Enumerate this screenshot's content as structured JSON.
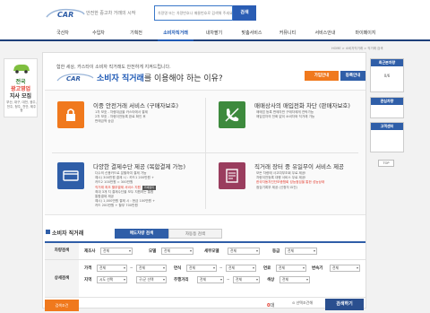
{
  "header": {
    "tagline": "안전한 중고차 거래의 시작",
    "search_placeholder": "차량명 또는 차량번호나 매물번호로 검색해 주세요",
    "search_button": "검색"
  },
  "nav": {
    "items": [
      "국산차",
      "수입차",
      "기획전",
      "소비자직거래",
      "내차팔기",
      "맞춤서비스",
      "커뮤니티",
      "서비스안내",
      "마이페이지"
    ],
    "active_index": 3
  },
  "left_banner": {
    "line1": "전국",
    "line2": "광고영업",
    "line3": "지사 모집",
    "sub": "부산, 대구, 대전, 광주, 전주, 청주, 천안, 제주 등"
  },
  "breadcrumb": "HOME > 소비자직거래 > 직거래 검색",
  "intro": {
    "text": "험한 세상, 카스타이 소비자 직거래도 안전하게 지켜드립니다.",
    "headline_pre": "",
    "headline_highlight": "소비자 직거래",
    "headline_post": "를 이용해야 하는 이유?",
    "btn_howto": "가입안내",
    "btn_register": "등록안내"
  },
  "features": [
    {
      "title": "이중 안전거래 서비스 (구매자보호)",
      "items": [
        "1차 보호 - 차량대금을 카스타에서 결제",
        "2차 보호 - 차량이전등록 완료 확인 후",
        "판매금액 송금"
      ],
      "color": "#f0791d",
      "icon": "lock-icon"
    },
    {
      "title": "매매상사의 매입전화 차단 (판매자보호)",
      "items": [
        "매매업 등록 판매자만 구매자에게 연락가능",
        "매입업자의 전화 없이 소비자와 직거래 가능"
      ],
      "color": "#3d8a3d",
      "icon": "phone-block-icon"
    },
    {
      "title": "다양한 결제수단 제공 (복합결제 가능)",
      "items": [
        "다수의 신용카드로 분할하여 결제 가능",
        "예시) 300만원 결제 시 : 카드1 200만원 +",
        "카드2 100만원 = 300만원",
        "직거래 최초 할부결제 서비스 지원",
        "최대 3개 지 결제수단을 모두 지원하는 통합",
        "통합결제 제공",
        "예시) 1,000만원 결제 시 : 현금 100만원 +",
        "카드 200만원 + 할부 700만원"
      ],
      "highlight_index": 3,
      "badge": "카세렌지",
      "color": "#2f5ea8",
      "icon": "card-icon"
    },
    {
      "title": "직거래 장터 중 유일무이 서비스 제공",
      "items": [
        "모든 차량에 사고여부조회 무료 제공!",
        "차량이전등록 대행 서비스 무료 제공!",
        "한국자동차진단보증협회 성능점검을 통한 성능상태",
        "점검기록부 제공 (신청자 요건)"
      ],
      "highlight_index": 2,
      "color": "#9a3d5e",
      "icon": "certificate-icon"
    }
  ],
  "search": {
    "title": "소비자 직거래",
    "tabs": [
      "매도차량 검색",
      "자동등 검색"
    ],
    "rows": {
      "vehicle_label": "차량검색",
      "detail_label": "상세검색",
      "maker_label": "제조사",
      "model_label": "모델",
      "submodel_label": "세부모델",
      "grade_label": "등급",
      "price_label": "가격",
      "year_label": "연식",
      "mileage_label": "연료",
      "km_label": "주행",
      "region_label": "지역",
      "color_label": "색상",
      "trans_label": "변속기",
      "fuel_label": "연식",
      "mission_label": "주행거리",
      "extra_label": "색상"
    },
    "select_default": "전체",
    "select_region": "시도 선택",
    "select_district": "구/군 선택",
    "result_count_label": "검색조건",
    "count_prefix": "",
    "count_value": "0",
    "count_suffix": "대",
    "reset_label": "선택조건해",
    "search_button": "검색하기"
  },
  "right_sidebar": {
    "box1": "최근본차량",
    "box2": "0/6",
    "box3": "관심차량",
    "box4": "고객센터",
    "top": "TOP"
  }
}
